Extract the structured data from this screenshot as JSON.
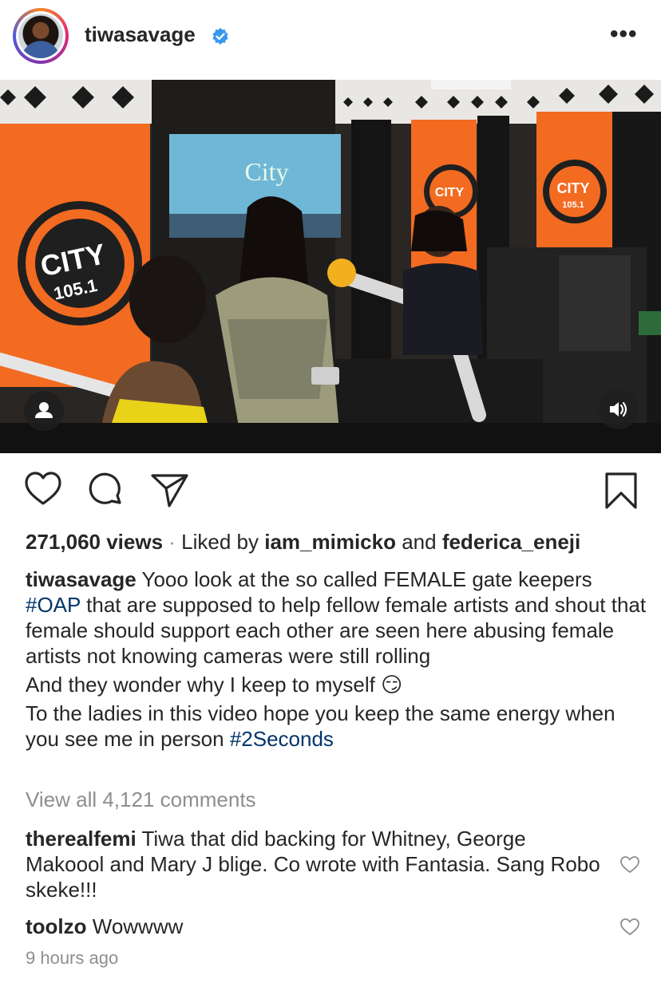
{
  "header": {
    "username": "tiwasavage",
    "verified": true,
    "more_icon": "more-horizontal-icon"
  },
  "media": {
    "type": "video",
    "screen_text": "City",
    "left_logo": {
      "brand": "CITY",
      "frequency": "105.1"
    },
    "right_logo": {
      "brand": "CITY",
      "frequency": "105.1"
    },
    "user_tag_icon": "user-icon",
    "sound_icon": "speaker-icon"
  },
  "actions": {
    "like_icon": "heart-icon",
    "comment_icon": "comment-bubble-icon",
    "share_icon": "paper-plane-icon",
    "save_icon": "bookmark-icon"
  },
  "stats": {
    "views": "271,060 views",
    "separator": " · ",
    "liked_by_prefix": "Liked by ",
    "liker_1": "iam_mimicko",
    "liked_by_and": " and ",
    "liker_2": "federica_eneji"
  },
  "caption": {
    "author": "tiwasavage",
    "line1_text": " Yooo look at the so called FEMALE gate keepers ",
    "hashtag_1": "#OAP",
    "line1_rest": " that are supposed to help fellow female artists and shout that female should support each other are seen here abusing female artists not knowing cameras were still rolling",
    "line2_text": "And they wonder why I keep to myself ",
    "emoji": "😏",
    "line3_text": "To the ladies in this video hope you keep the same energy when you see me in person ",
    "hashtag_2": "#2Seconds"
  },
  "view_all_comments": "View all 4,121 comments",
  "comments": [
    {
      "user": "therealfemi",
      "text": " Tiwa that did backing for Whitney, George Makoool and Mary J blige. Co wrote with Fantasia. Sang Robo skeke!!!"
    },
    {
      "user": "toolzo",
      "text": " Wowwww"
    }
  ],
  "timestamp": "9 hours ago",
  "colors": {
    "text": "#262626",
    "secondary": "#8e8e8e",
    "hashtag": "#003569",
    "verified": "#3897f0",
    "brand_orange": "#f26b21"
  }
}
